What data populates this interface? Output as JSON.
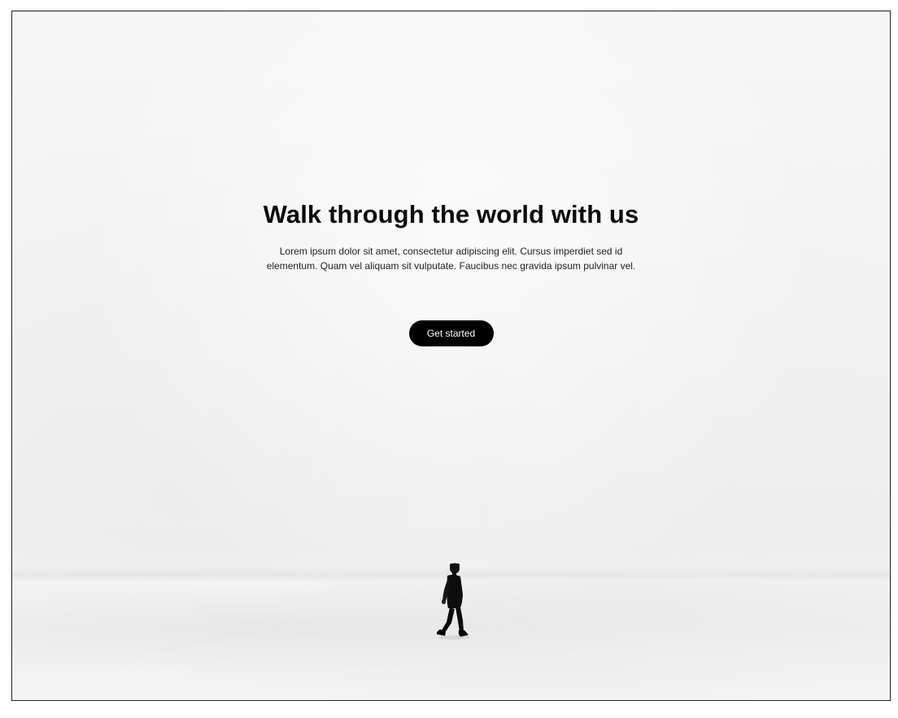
{
  "hero": {
    "title": "Walk through the world with us",
    "description": "Lorem ipsum dolor sit amet, consectetur adipiscing elit. Cursus imperdiet sed id elementum. Quam vel aliquam sit vulputate. Faucibus nec gravida ipsum pulvinar vel.",
    "cta_label": "Get started"
  },
  "colors": {
    "text": "#0a0a0a",
    "button_bg": "#000000",
    "button_text": "#ffffff",
    "background": "#f3f3f3"
  },
  "icons": {
    "figure": "walking-person-illustration"
  }
}
